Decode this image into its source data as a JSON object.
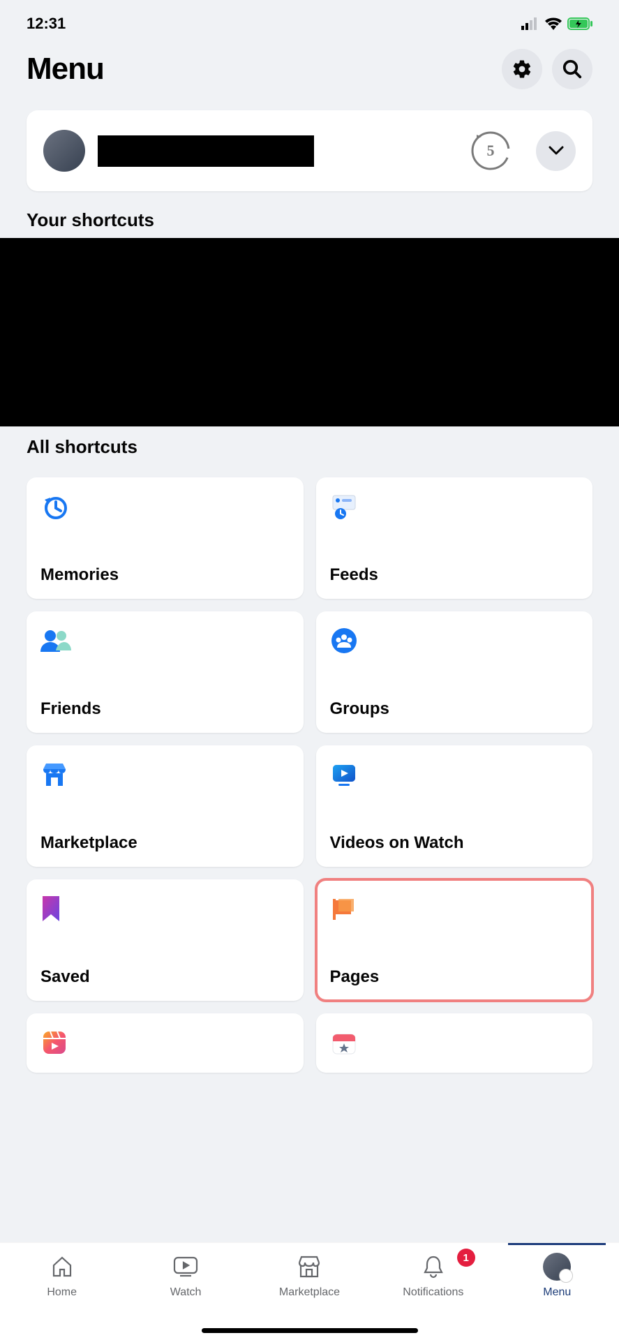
{
  "status": {
    "time": "12:31"
  },
  "header": {
    "title": "Menu"
  },
  "sections": {
    "your_shortcuts": "Your shortcuts",
    "all_shortcuts": "All shortcuts"
  },
  "shortcuts": {
    "memories": "Memories",
    "feeds": "Feeds",
    "friends": "Friends",
    "groups": "Groups",
    "marketplace": "Marketplace",
    "videos": "Videos on Watch",
    "saved": "Saved",
    "pages": "Pages"
  },
  "nav": {
    "home": "Home",
    "watch": "Watch",
    "marketplace": "Marketplace",
    "notifications": "Notifications",
    "menu": "Menu",
    "badge": "1"
  }
}
